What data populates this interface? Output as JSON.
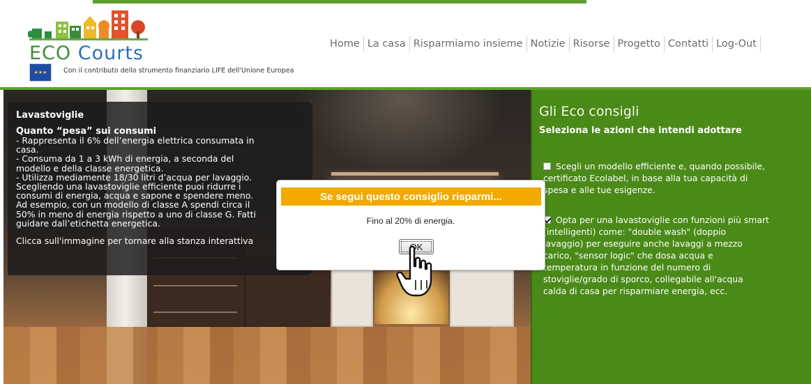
{
  "header": {
    "logo": {
      "eco": "ECO",
      "courts": "Courts"
    },
    "eu_text": "Con il contributo dello strumento finanziario LIFE dell'Unione Europea",
    "nav": [
      "Home",
      "La casa",
      "Risparmiamo insieme",
      "Notizie",
      "Risorse",
      "Progetto",
      "Contatti",
      "Log-Out"
    ]
  },
  "info": {
    "title": "Lavastoviglie",
    "subtitle": "Quanto “pesa” sui consumi",
    "lines": [
      "- Rappresenta il 6% dell’energia elettrica consumata in",
      "casa.",
      "- Consuma da 1 a 3 kWh di energia, a seconda del",
      "modello e della classe  energetica.",
      "- Utilizza mediamente 18/30 litri d’acqua per lavaggio.",
      "Scegliendo una lavastoviglie efficiente puoi ridurre i",
      "consumi di energia, acqua e sapone e spendere meno.",
      "Ad esempio, con un modello di classe A spendi circa il",
      "50% in meno di energia rispetto a uno di classe G. Fatti",
      "guidare dall’etichetta energetica."
    ],
    "footer": "Clicca sull'immagine per tornare alla stanza interattiva"
  },
  "tips": {
    "title": "Gli Eco consigli",
    "subtitle": "Seleziona le azioni che intendi adottare",
    "items": [
      {
        "checked": false,
        "lines": [
          "Scegli un modello efficiente e, quando possibile,",
          "certificato Ecolabel, in base alla tua capacità di",
          "spesa e alle tue esigenze."
        ]
      },
      {
        "checked": true,
        "lines": [
          "Opta per una lavastoviglie con funzioni più smart",
          "(intelligenti) come: \"double wash\" (doppio",
          "lavaggio) per eseguire anche lavaggi a mezzo",
          "carico, \"sensor logic\" che dosa acqua e",
          "temperatura in funzione del numero di",
          "stoviglie/grado di sporco, collegabile all'acqua",
          "calda di casa per risparmiare energia, ecc."
        ]
      }
    ]
  },
  "modal": {
    "title": "Se segui questo consiglio risparmi...",
    "message": "Fino al 20% di energia.",
    "ok_label": "OK"
  },
  "colors": {
    "green_panel": "#4a8a18",
    "modal_header": "#f2a900",
    "nav_text": "#6b6b6b"
  }
}
